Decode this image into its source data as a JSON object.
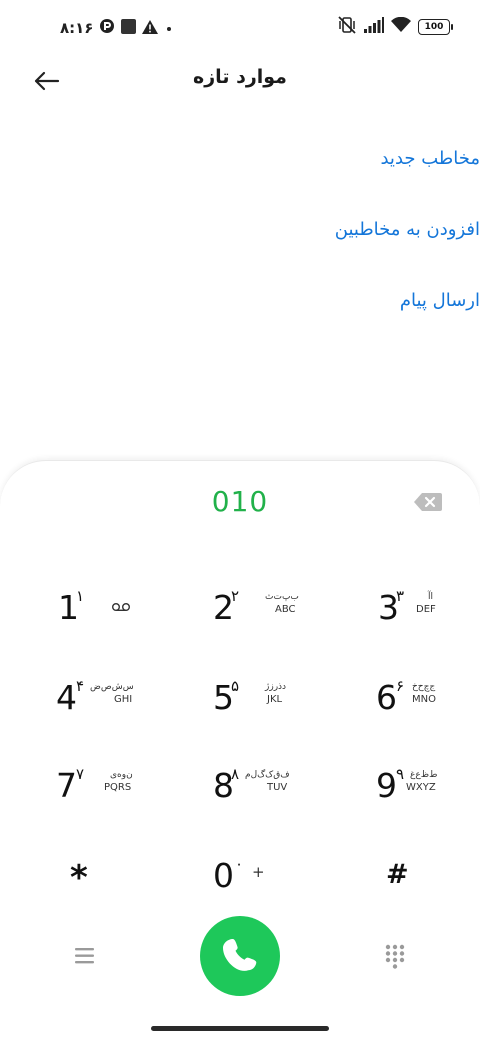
{
  "status_bar": {
    "time": "۸:۱۶",
    "battery": "100"
  },
  "header": {
    "title": "موارد تازه"
  },
  "actions": [
    {
      "label": "مخاطب جدید"
    },
    {
      "label": "افزودن به مخاطبین"
    },
    {
      "label": "ارسال پیام"
    }
  ],
  "dialer": {
    "number": "010",
    "keys": [
      {
        "digit": "1",
        "fa": "۱",
        "fa_letters": "",
        "latin": ""
      },
      {
        "digit": "2",
        "fa": "۲",
        "fa_letters": "ب‌پ‌ت‌ث",
        "latin": "ABC"
      },
      {
        "digit": "3",
        "fa": "۳",
        "fa_letters": "اآ",
        "latin": "DEF"
      },
      {
        "digit": "4",
        "fa": "۴",
        "fa_letters": "س‌ش‌ص‌ض",
        "latin": "GHI"
      },
      {
        "digit": "5",
        "fa": "۵",
        "fa_letters": "د‌ذ‌ر‌ز‌ژ",
        "latin": "JKL"
      },
      {
        "digit": "6",
        "fa": "۶",
        "fa_letters": "ج‌چ‌ح‌خ",
        "latin": "MNO"
      },
      {
        "digit": "7",
        "fa": "۷",
        "fa_letters": "ن‌و‌ه‌ی",
        "latin": "PQRS"
      },
      {
        "digit": "8",
        "fa": "۸",
        "fa_letters": "ف‌ق‌ک‌گ‌ل‌م",
        "latin": "TUV"
      },
      {
        "digit": "9",
        "fa": "۹",
        "fa_letters": "ط‌ظ‌ع‌غ",
        "latin": "WXYZ"
      },
      {
        "digit": "*",
        "fa": "",
        "fa_letters": "",
        "latin": ""
      },
      {
        "digit": "0",
        "fa": "۰",
        "fa_letters": "",
        "latin": "+"
      },
      {
        "digit": "#",
        "fa": "",
        "fa_letters": "",
        "latin": ""
      }
    ]
  },
  "colors": {
    "accent_green": "#21b14a",
    "call_green": "#1ec85a",
    "link_blue": "#1476d9"
  },
  "icons": {
    "back": "arrow-left-icon",
    "backspace": "backspace-icon",
    "voicemail": "voicemail-icon",
    "call": "phone-icon",
    "menu": "menu-icon",
    "keypad": "dialpad-icon"
  }
}
